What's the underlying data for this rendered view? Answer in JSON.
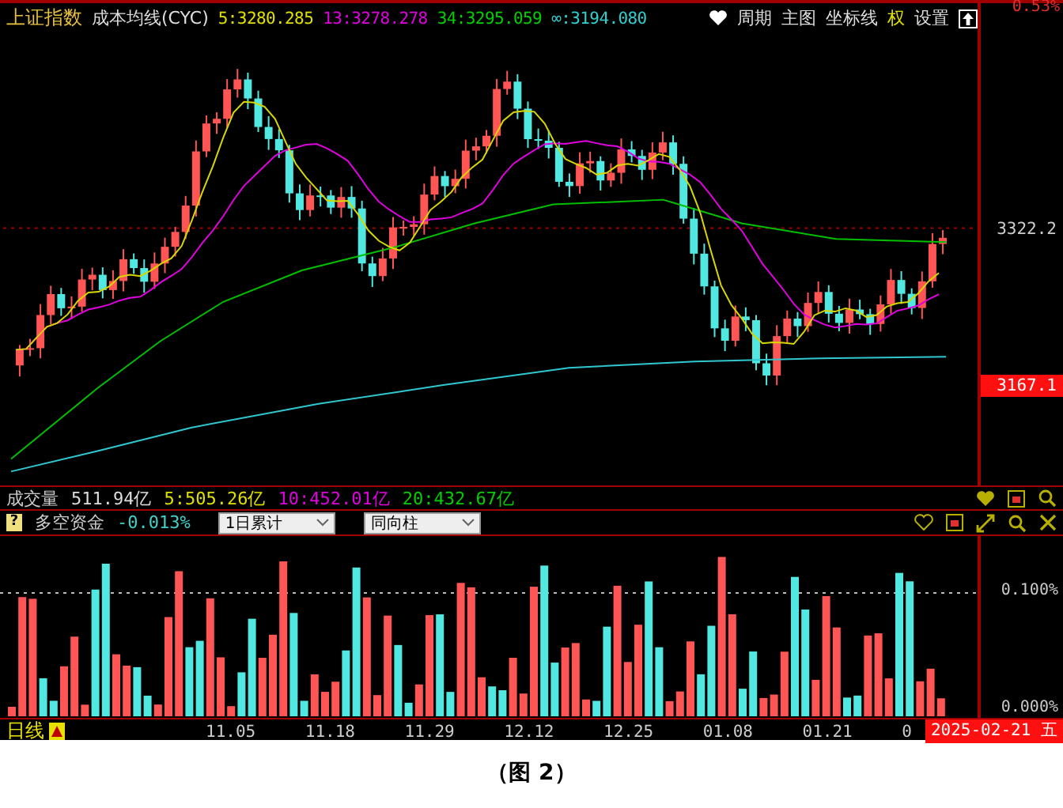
{
  "header": {
    "index_name": "上证指数",
    "indicator": "成本均线(CYC)",
    "values": [
      {
        "label": "5:3280.285",
        "color": "#e0e000"
      },
      {
        "label": "13:3278.278",
        "color": "#e000e0"
      },
      {
        "label": "34:3295.059",
        "color": "#00d000"
      },
      {
        "label": "∞:3194.080",
        "color": "#30d0d0"
      }
    ],
    "menu": [
      "周期",
      "主图",
      "坐标线",
      "权",
      "设置"
    ]
  },
  "price_axis": {
    "top_label": "0.53%",
    "labels": [
      {
        "text": "3322.2",
        "kind": "plain"
      },
      {
        "text": "3167.1",
        "kind": "highlight"
      }
    ]
  },
  "volume_header": {
    "title": "成交量",
    "total": "511.94亿",
    "values": [
      {
        "label": "5:505.26亿",
        "color": "#e0e000"
      },
      {
        "label": "10:452.01亿",
        "color": "#e000e0"
      },
      {
        "label": "20:432.67亿",
        "color": "#00d000"
      }
    ]
  },
  "indicator_header": {
    "help": "?",
    "title": "多空资金",
    "value": "-0.013%",
    "dropdowns": [
      {
        "value": "1日累计"
      },
      {
        "value": "同向柱"
      }
    ]
  },
  "indicator_axis": [
    "0.100%",
    "0.000%"
  ],
  "date_axis": {
    "period": "日线",
    "dates": [
      "11.05",
      "11.18",
      "11.29",
      "12.12",
      "12.25",
      "01.08",
      "01.21",
      "0"
    ],
    "current": "2025-02-21 五"
  },
  "caption": "（图 2）"
}
